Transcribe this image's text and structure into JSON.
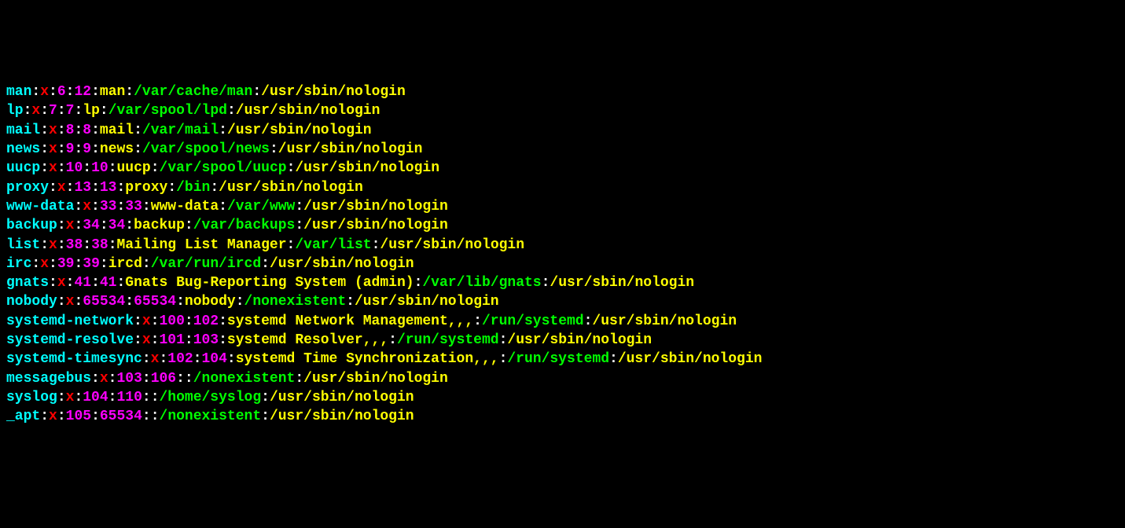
{
  "terminal": {
    "entries": [
      {
        "user": "man",
        "x": "x",
        "uid": "6",
        "gid": "12",
        "gecos": "man",
        "home": "/var/cache/man",
        "shell": "/usr/sbin/nologin"
      },
      {
        "user": "lp",
        "x": "x",
        "uid": "7",
        "gid": "7",
        "gecos": "lp",
        "home": "/var/spool/lpd",
        "shell": "/usr/sbin/nologin"
      },
      {
        "user": "mail",
        "x": "x",
        "uid": "8",
        "gid": "8",
        "gecos": "mail",
        "home": "/var/mail",
        "shell": "/usr/sbin/nologin"
      },
      {
        "user": "news",
        "x": "x",
        "uid": "9",
        "gid": "9",
        "gecos": "news",
        "home": "/var/spool/news",
        "shell": "/usr/sbin/nologin"
      },
      {
        "user": "uucp",
        "x": "x",
        "uid": "10",
        "gid": "10",
        "gecos": "uucp",
        "home": "/var/spool/uucp",
        "shell": "/usr/sbin/nologin"
      },
      {
        "user": "proxy",
        "x": "x",
        "uid": "13",
        "gid": "13",
        "gecos": "proxy",
        "home": "/bin",
        "shell": "/usr/sbin/nologin"
      },
      {
        "user": "www-data",
        "x": "x",
        "uid": "33",
        "gid": "33",
        "gecos": "www-data",
        "home": "/var/www",
        "shell": "/usr/sbin/nologin"
      },
      {
        "user": "backup",
        "x": "x",
        "uid": "34",
        "gid": "34",
        "gecos": "backup",
        "home": "/var/backups",
        "shell": "/usr/sbin/nologin"
      },
      {
        "user": "list",
        "x": "x",
        "uid": "38",
        "gid": "38",
        "gecos": "Mailing List Manager",
        "home": "/var/list",
        "shell": "/usr/sbin/nologin"
      },
      {
        "user": "irc",
        "x": "x",
        "uid": "39",
        "gid": "39",
        "gecos": "ircd",
        "home": "/var/run/ircd",
        "shell": "/usr/sbin/nologin"
      },
      {
        "user": "gnats",
        "x": "x",
        "uid": "41",
        "gid": "41",
        "gecos": "Gnats Bug-Reporting System (admin)",
        "home": "/var/lib/gnats",
        "shell": "/usr/sbin/nologin"
      },
      {
        "user": "nobody",
        "x": "x",
        "uid": "65534",
        "gid": "65534",
        "gecos": "nobody",
        "home": "/nonexistent",
        "shell": "/usr/sbin/nologin"
      },
      {
        "user": "systemd-network",
        "x": "x",
        "uid": "100",
        "gid": "102",
        "gecos": "systemd Network Management,,,",
        "home": "/run/systemd",
        "shell": "/usr/sbin/nologin"
      },
      {
        "user": "systemd-resolve",
        "x": "x",
        "uid": "101",
        "gid": "103",
        "gecos": "systemd Resolver,,,",
        "home": "/run/systemd",
        "shell": "/usr/sbin/nologin"
      },
      {
        "user": "systemd-timesync",
        "x": "x",
        "uid": "102",
        "gid": "104",
        "gecos": "systemd Time Synchronization,,,",
        "home": "/run/systemd",
        "shell": "/usr/sbin/nologin"
      },
      {
        "user": "messagebus",
        "x": "x",
        "uid": "103",
        "gid": "106",
        "gecos": "",
        "home": "/nonexistent",
        "shell": "/usr/sbin/nologin"
      },
      {
        "user": "syslog",
        "x": "x",
        "uid": "104",
        "gid": "110",
        "gecos": "",
        "home": "/home/syslog",
        "shell": "/usr/sbin/nologin"
      },
      {
        "user": "_apt",
        "x": "x",
        "uid": "105",
        "gid": "65534",
        "gecos": "",
        "home": "/nonexistent",
        "shell": "/usr/sbin/nologin"
      }
    ]
  }
}
